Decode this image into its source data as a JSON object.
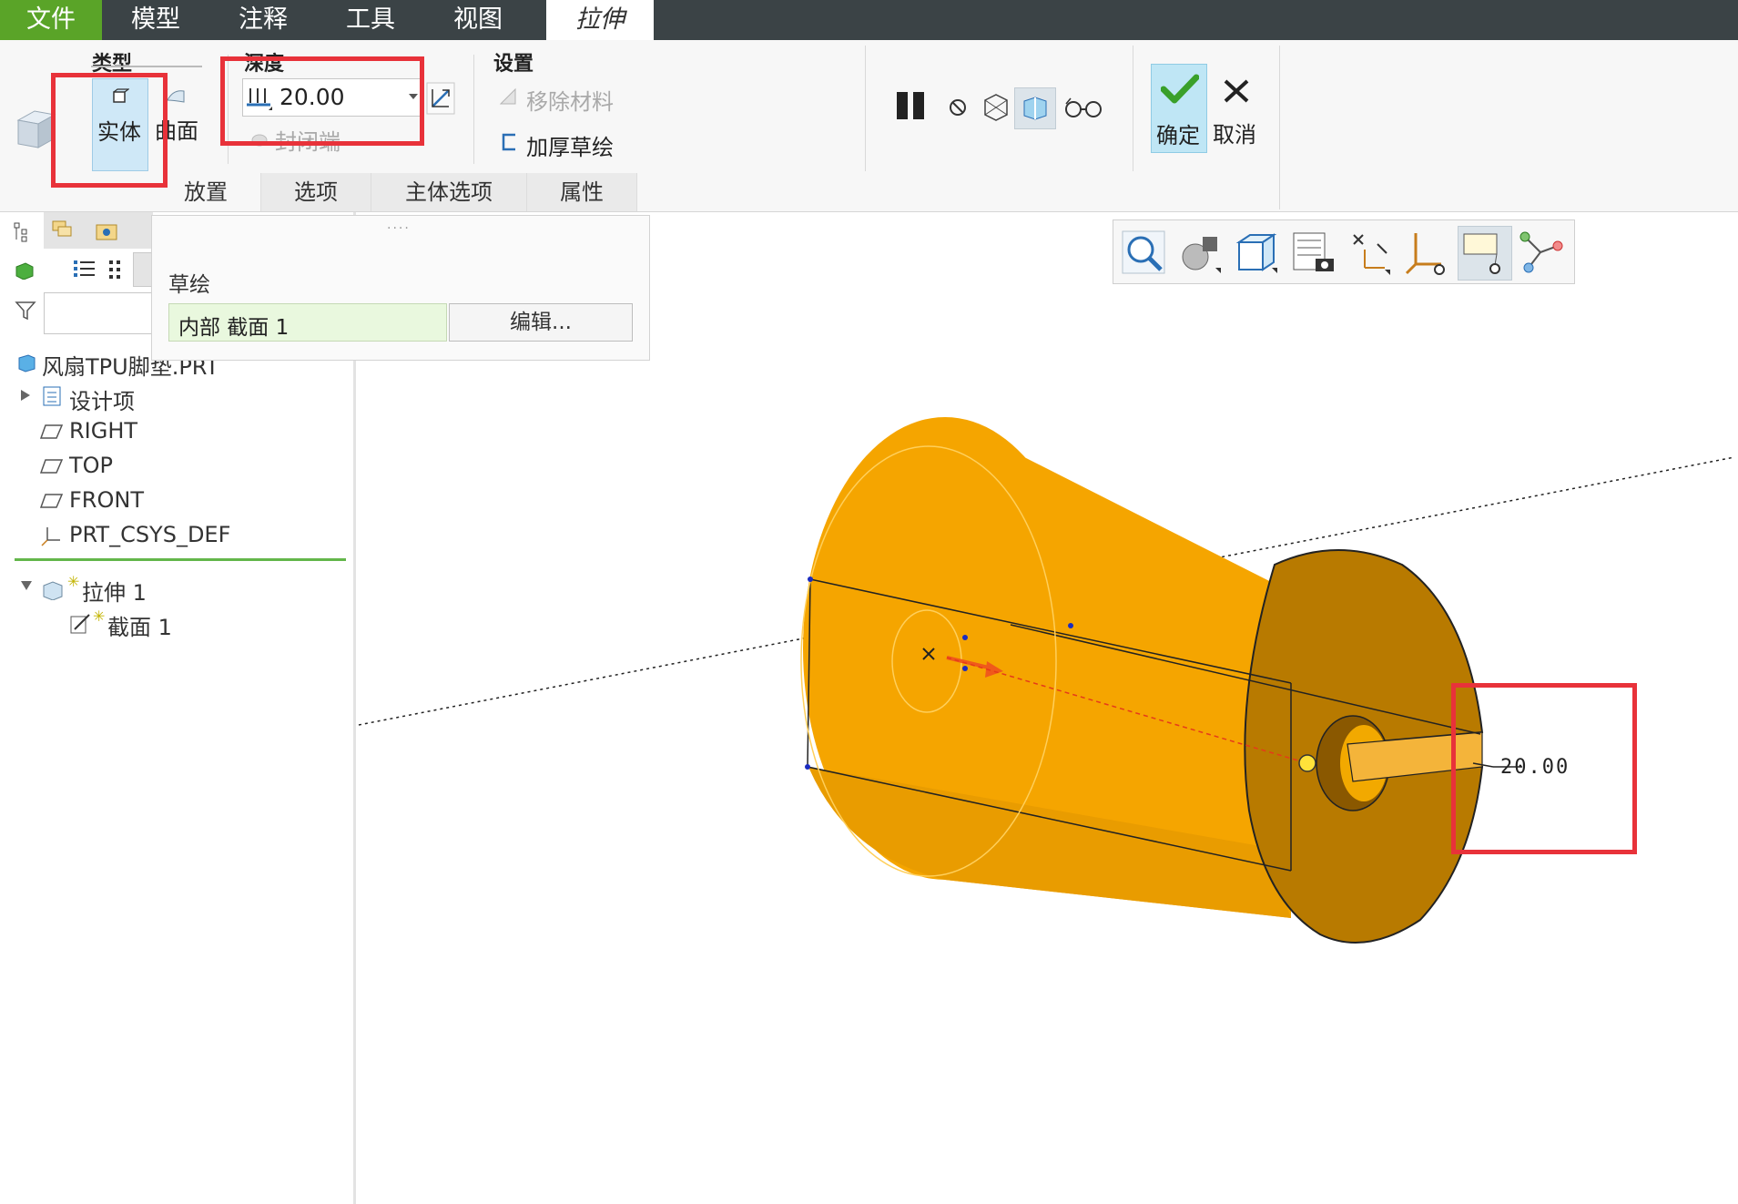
{
  "menu": {
    "tabs": [
      "文件",
      "模型",
      "注释",
      "工具",
      "视图",
      "拉伸"
    ],
    "active_tab": "拉伸"
  },
  "ribbon": {
    "type_group": {
      "label": "类型",
      "solid": "实体",
      "surface": "曲面"
    },
    "depth_group": {
      "label": "深度",
      "value": "20.00",
      "cap_ends": "封闭端"
    },
    "settings_group": {
      "label": "设置",
      "remove_material": "移除材料",
      "thicken_sketch": "加厚草绘"
    },
    "ok": "确定",
    "cancel": "取消",
    "subtabs": [
      "放置",
      "选项",
      "主体选项",
      "属性"
    ]
  },
  "placement_panel": {
    "sketch_label": "草绘",
    "section_value": "内部 截面 1",
    "edit_button": "编辑..."
  },
  "model_tree": {
    "part_name": "风扇TPU脚垫.PRT",
    "items": [
      "设计项",
      "RIGHT",
      "TOP",
      "FRONT",
      "PRT_CSYS_DEF"
    ],
    "feature": "拉伸 1",
    "feature_child": "截面 1"
  },
  "viewport": {
    "dimension_label": "20.00",
    "model_color": "#f5a500"
  },
  "colors": {
    "menubar": "#3b4346",
    "file_tab": "#5aa428",
    "highlight_box": "#e8323a",
    "ok_green": "#3aa02a"
  }
}
